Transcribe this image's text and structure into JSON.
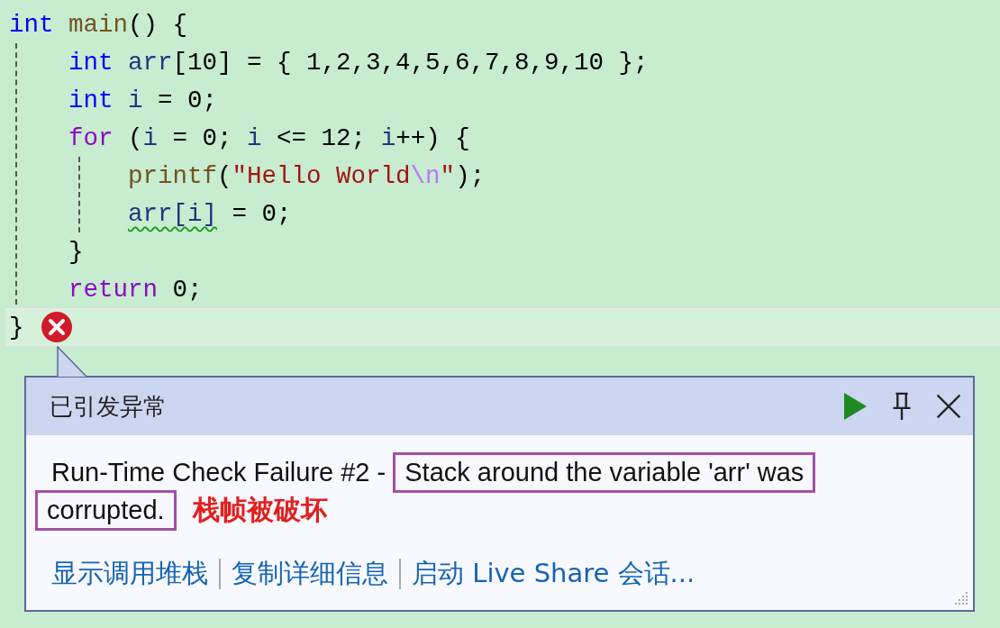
{
  "code_lines": [
    {
      "current": false,
      "tokens": [
        {
          "t": "int",
          "kind": "keyword"
        },
        {
          "t": " main",
          "kind": "function"
        },
        {
          "t": "() {",
          "kind": "plain"
        }
      ],
      "children": [
        {
          "current": false,
          "tokens": [
            {
              "t": "int",
              "kind": "keyword"
            },
            {
              "t": " arr",
              "kind": "variable"
            },
            {
              "t": "[10] = { 1,2,3,4,5,6,7,8,9,10 };",
              "kind": "plain"
            }
          ]
        },
        {
          "current": false,
          "tokens": [
            {
              "t": "int",
              "kind": "keyword"
            },
            {
              "t": " i",
              "kind": "variable"
            },
            {
              "t": " = 0;",
              "kind": "plain"
            }
          ]
        },
        {
          "current": false,
          "tokens": [
            {
              "t": "for",
              "kind": "control"
            },
            {
              "t": " (",
              "kind": "plain"
            },
            {
              "t": "i",
              "kind": "variable"
            },
            {
              "t": " = 0; ",
              "kind": "plain"
            },
            {
              "t": "i",
              "kind": "variable"
            },
            {
              "t": " <= 12; ",
              "kind": "plain"
            },
            {
              "t": "i",
              "kind": "variable"
            },
            {
              "t": "++) {",
              "kind": "plain"
            }
          ],
          "children": [
            {
              "current": false,
              "tokens": [
                {
                  "t": "printf",
                  "kind": "function"
                },
                {
                  "t": "(",
                  "kind": "plain"
                },
                {
                  "t": "\"Hello World",
                  "kind": "string"
                },
                {
                  "t": "\\n",
                  "kind": "escape"
                },
                {
                  "t": "\"",
                  "kind": "string"
                },
                {
                  "t": ");",
                  "kind": "plain"
                }
              ]
            },
            {
              "current": false,
              "tokens": [
                {
                  "t": "arr[i]",
                  "kind": "warning"
                },
                {
                  "t": " = 0;",
                  "kind": "plain"
                }
              ]
            }
          ]
        },
        {
          "current": false,
          "tokens": [
            {
              "t": "}",
              "kind": "plain"
            }
          ]
        },
        {
          "current": false,
          "tokens": [
            {
              "t": "return",
              "kind": "control"
            },
            {
              "t": " 0;",
              "kind": "plain"
            }
          ]
        }
      ]
    },
    {
      "current": true,
      "tokens": [
        {
          "t": "}",
          "kind": "plain"
        }
      ]
    }
  ],
  "popup": {
    "title": "已引发异常",
    "message_lines": [
      [
        {
          "text": "Run-Time Check Failure #2 - ",
          "highlighted": false
        },
        {
          "text": "Stack around the variable 'arr' was",
          "highlighted": true
        }
      ],
      [
        {
          "text": "corrupted.",
          "highlighted": true
        }
      ]
    ],
    "annotation": "栈帧被破坏",
    "links": [
      "显示调用堆栈",
      "复制详细信息",
      "启动 Live Share 会话..."
    ]
  }
}
